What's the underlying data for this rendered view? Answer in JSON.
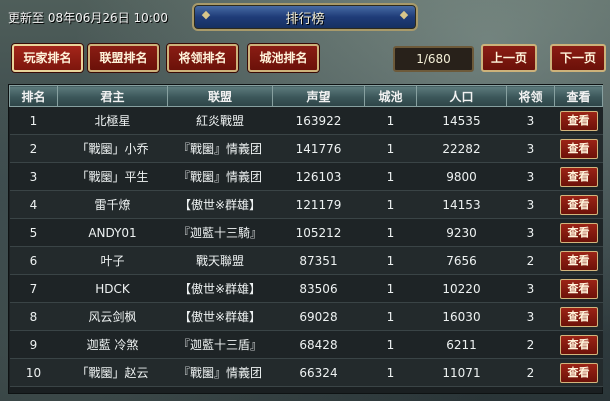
{
  "updated_text": "更新至 08年06月26日 10:00",
  "title": "排行榜",
  "tabs": [
    {
      "label": "玩家排名"
    },
    {
      "label": "联盟排名"
    },
    {
      "label": "将领排名"
    },
    {
      "label": "城池排名"
    }
  ],
  "pager": {
    "text": "1/680",
    "prev_label": "上一页",
    "next_label": "下一页"
  },
  "columns": [
    "排名",
    "君主",
    "联盟",
    "声望",
    "城池",
    "人口",
    "将领",
    "查看"
  ],
  "view_label": "查看",
  "rows": [
    {
      "rank": "1",
      "lord": "北極星",
      "alliance": "紅炎戰盟",
      "prestige": "163922",
      "cities": "1",
      "population": "14535",
      "generals": "3"
    },
    {
      "rank": "2",
      "lord": "「戰圞」小乔",
      "alliance": "『戰圞』情義团",
      "prestige": "141776",
      "cities": "1",
      "population": "22282",
      "generals": "3"
    },
    {
      "rank": "3",
      "lord": "「戰圞」平生",
      "alliance": "『戰圞』情義团",
      "prestige": "126103",
      "cities": "1",
      "population": "9800",
      "generals": "3"
    },
    {
      "rank": "4",
      "lord": "雷千燎",
      "alliance": "【傲世※群雄】",
      "prestige": "121179",
      "cities": "1",
      "population": "14153",
      "generals": "3"
    },
    {
      "rank": "5",
      "lord": "ANDY01",
      "alliance": "『迦藍十三騎』",
      "prestige": "105212",
      "cities": "1",
      "population": "9230",
      "generals": "3"
    },
    {
      "rank": "6",
      "lord": "叶子",
      "alliance": "戰天聯盟",
      "prestige": "87351",
      "cities": "1",
      "population": "7656",
      "generals": "2"
    },
    {
      "rank": "7",
      "lord": "HDCK",
      "alliance": "【傲世※群雄】",
      "prestige": "83506",
      "cities": "1",
      "population": "10220",
      "generals": "3"
    },
    {
      "rank": "8",
      "lord": "风云剑枫",
      "alliance": "【傲世※群雄】",
      "prestige": "69028",
      "cities": "1",
      "population": "16030",
      "generals": "3"
    },
    {
      "rank": "9",
      "lord": "迦藍 冷煞",
      "alliance": "『迦藍十三盾』",
      "prestige": "68428",
      "cities": "1",
      "population": "6211",
      "generals": "2"
    },
    {
      "rank": "10",
      "lord": "「戰圞」赵云",
      "alliance": "『戰圞』情義团",
      "prestige": "66324",
      "cities": "1",
      "population": "11071",
      "generals": "2"
    }
  ]
}
